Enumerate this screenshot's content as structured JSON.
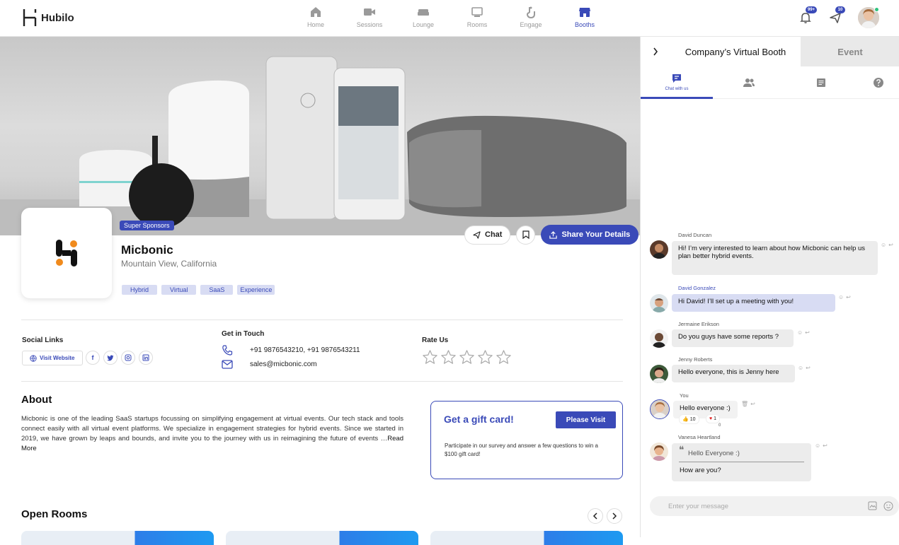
{
  "brand": {
    "name": "Hubilo"
  },
  "nav": {
    "tabs": [
      {
        "label": "Home"
      },
      {
        "label": "Sessions"
      },
      {
        "label": "Lounge"
      },
      {
        "label": "Rooms"
      },
      {
        "label": "Engage"
      },
      {
        "label": "Booths"
      }
    ],
    "active": "Booths",
    "notifications_badge": "99+",
    "chat_badge": "10"
  },
  "company": {
    "sponsor_badge": "Super Sponsors",
    "name": "Micbonic",
    "location": "Mountain View, California",
    "tags": [
      "Hybrid",
      "Virtual",
      "SaaS",
      "Experience"
    ],
    "actions": {
      "chat": "Chat",
      "share": "Share Your Details"
    }
  },
  "social": {
    "title": "Social Links",
    "visit_website": "Visit Website",
    "icons": [
      "facebook-icon",
      "twitter-icon",
      "instagram-icon",
      "linkedin-icon"
    ]
  },
  "contact": {
    "title": "Get in Touch",
    "phone": "+91 9876543210, +91 9876543211",
    "email": "sales@micbonic.com"
  },
  "rating": {
    "title": "Rate Us",
    "stars": 5,
    "value": 0
  },
  "about": {
    "title": "About",
    "text": "Micbonic is one of the leading SaaS startups focussing on simplifying engagement at virtual events. Our tech stack and tools connect easily with all virtual event platforms. We specialize in engagement strategies for hybrid events. Since we started in 2019, we have grown by leaps and bounds, and invite you to the journey with us in reimagining the future of events …",
    "read_more": "Read More"
  },
  "gift": {
    "title": "Get a gift card!",
    "button": "Please Visit",
    "description": "Participate in our survey and answer a few questions to win a $100 gift card!"
  },
  "rooms": {
    "title": "Open Rooms"
  },
  "panel": {
    "tabs": {
      "booth": "Company’s Virtual Booth",
      "event": "Event"
    },
    "subtabs": {
      "chat": "Chat with us"
    },
    "messages": [
      {
        "name": "David Duncan",
        "text": "Hi! I’m very interested to learn about how Micbonic can help us plan better hybrid events."
      },
      {
        "name": "David Gonzalez",
        "text": "Hi David! I’ll set up a meeting with you!"
      },
      {
        "name": "Jermaine Erikson",
        "text": "Do you guys have some reports ?"
      },
      {
        "name": "Jenny Roberts",
        "text": "Hello everyone, this is Jenny here"
      },
      {
        "name": "You",
        "text": "Hello everyone :)",
        "reactions": {
          "thumbs": "10",
          "heart": "1",
          "extra": "0"
        }
      },
      {
        "name": "Vanesa Heartland",
        "quote": "Hello Everyone :)",
        "text": "How are you?"
      }
    ],
    "input_placeholder": "Enter your message"
  },
  "colors": {
    "accent": "#3a4ab8",
    "badge": "#3a4ab8",
    "online": "#2ec27e",
    "logo_orange": "#f08a1c"
  }
}
